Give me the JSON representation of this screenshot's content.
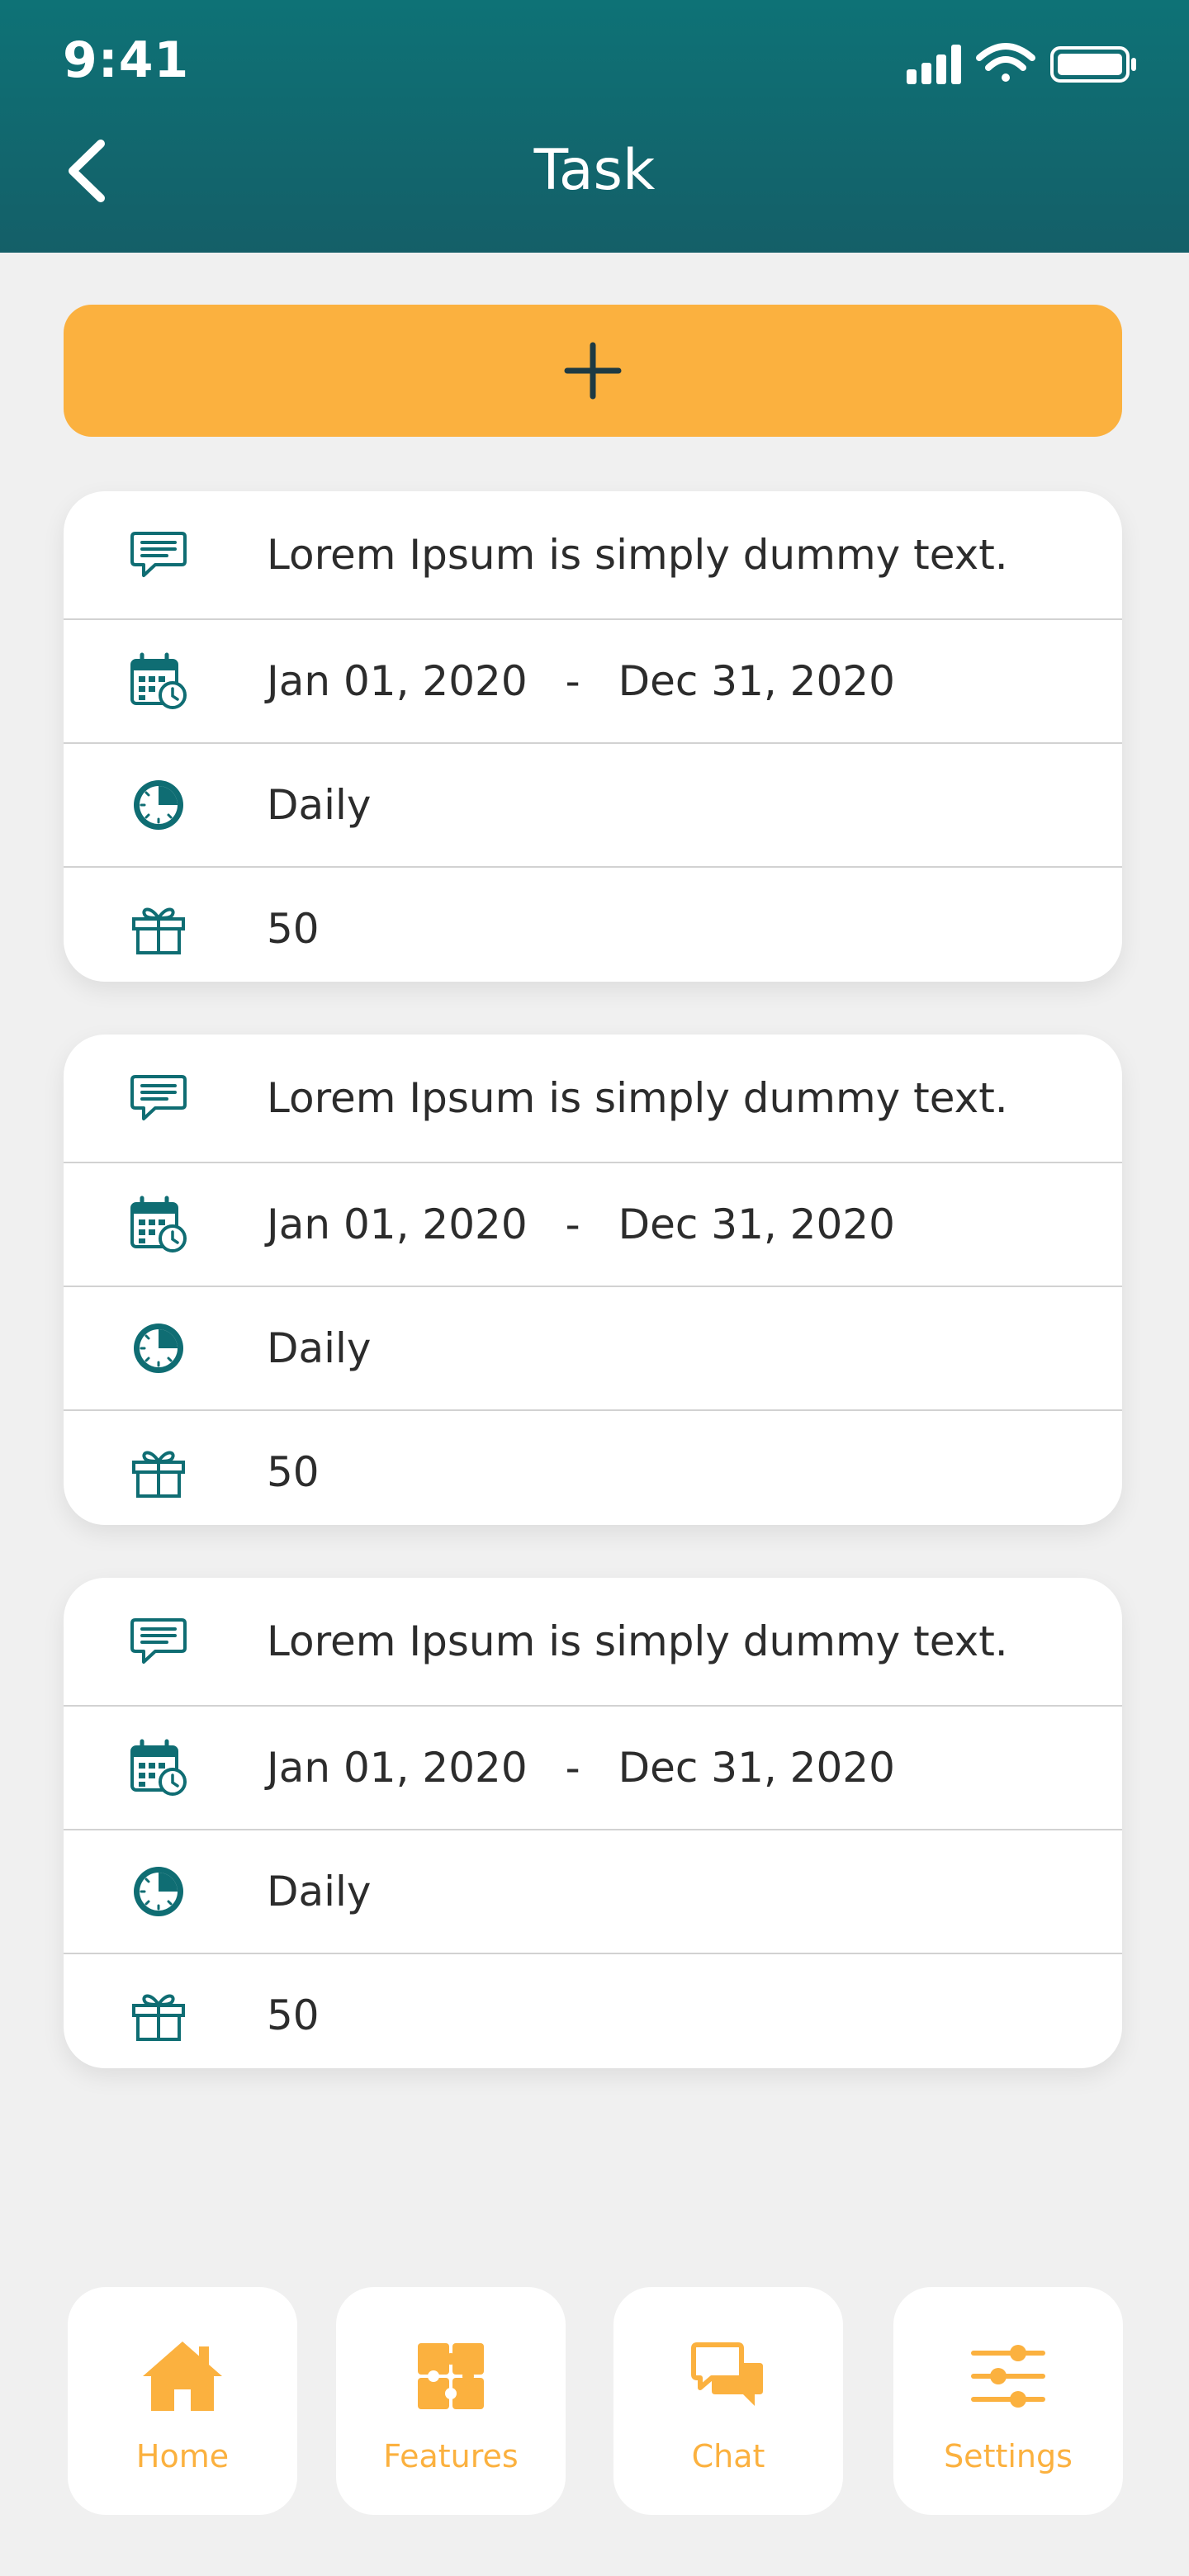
{
  "status_bar": {
    "time": "9:41"
  },
  "header": {
    "title": "Task",
    "back_icon": "chevron-left-icon"
  },
  "add_button": {
    "icon": "plus-icon"
  },
  "tasks": [
    {
      "description": "Lorem Ipsum is simply dummy text.",
      "start_date": "Jan 01, 2020",
      "date_separator": "-",
      "end_date": "Dec 31, 2020",
      "frequency": "Daily",
      "reward": "50"
    },
    {
      "description": "Lorem Ipsum is simply dummy text.",
      "start_date": "Jan 01, 2020",
      "date_separator": "-",
      "end_date": "Dec 31, 2020",
      "frequency": "Daily",
      "reward": "50"
    },
    {
      "description": "Lorem Ipsum is simply dummy text.",
      "start_date": "Jan 01, 2020",
      "date_separator": "-",
      "end_date": "Dec 31, 2020",
      "frequency": "Daily",
      "reward": "50"
    }
  ],
  "tabbar": {
    "items": [
      {
        "label": "Home",
        "icon": "home-icon"
      },
      {
        "label": "Features",
        "icon": "puzzle-icon"
      },
      {
        "label": "Chat",
        "icon": "chat-icon"
      },
      {
        "label": "Settings",
        "icon": "sliders-icon"
      }
    ]
  },
  "colors": {
    "header_start": "#0e7276",
    "header_end": "#145f68",
    "accent_orange": "#fbb13f",
    "icon_teal": "#0f6d73",
    "background": "#f0f0f0",
    "text_dark": "#2c2c2c"
  }
}
